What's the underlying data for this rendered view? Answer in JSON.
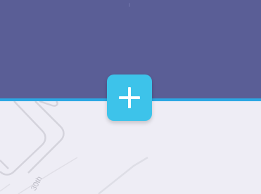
{
  "header": {
    "background_color": "#5a5e96"
  },
  "accent": {
    "color": "#2ba7e3"
  },
  "content": {
    "background_color": "#eeedf5"
  },
  "add_button": {
    "icon": "plus-icon",
    "color": "#3dc3ea"
  }
}
